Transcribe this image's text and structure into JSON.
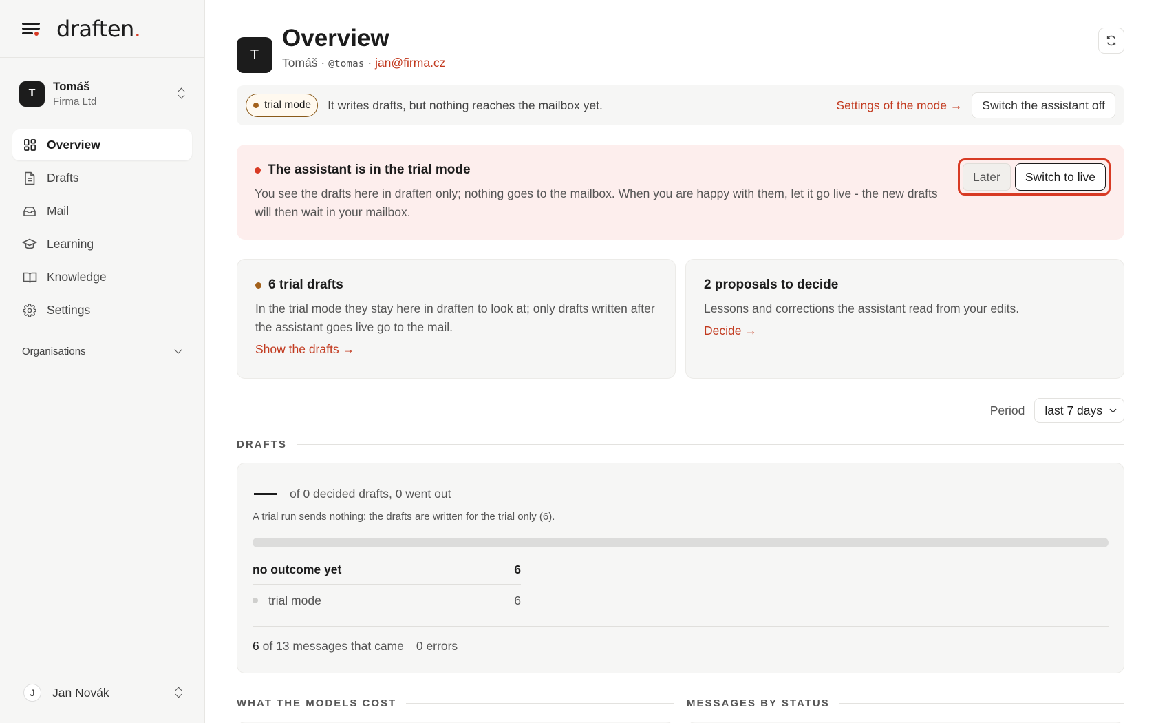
{
  "brand": {
    "name": "draften",
    "dot": ".",
    "accent": "#d83a24"
  },
  "account": {
    "initial": "T",
    "name": "Tomáš",
    "org": "Firma Ltd"
  },
  "nav": {
    "items": [
      {
        "label": "Overview",
        "icon": "grid-icon",
        "active": true
      },
      {
        "label": "Drafts",
        "icon": "document-icon",
        "active": false
      },
      {
        "label": "Mail",
        "icon": "inbox-icon",
        "active": false
      },
      {
        "label": "Learning",
        "icon": "graduation-cap-icon",
        "active": false
      },
      {
        "label": "Knowledge",
        "icon": "book-icon",
        "active": false
      },
      {
        "label": "Settings",
        "icon": "gear-icon",
        "active": false
      }
    ],
    "organisations_label": "Organisations"
  },
  "user": {
    "initial": "J",
    "name": "Jan Novák"
  },
  "header": {
    "initial": "T",
    "title": "Overview",
    "name": "Tomáš",
    "separator": " · ",
    "handle": "@tomas",
    "email": "jan@firma.cz"
  },
  "mode_bar": {
    "badge": "trial mode",
    "text": "It writes drafts, but nothing reaches the mailbox yet.",
    "settings_link": "Settings of the mode →",
    "off_button": "Switch the assistant off"
  },
  "alert": {
    "title": "The assistant is in the trial mode",
    "body": "You see the drafts here in draften only; nothing goes to the mailbox. When you are happy with them, let it go live - the new drafts will then wait in your mailbox.",
    "later_button": "Later",
    "live_button": "Switch to live"
  },
  "cards": {
    "trial": {
      "title": "6 trial drafts",
      "body": "In the trial mode they stay here in draften to look at; only drafts written after the assistant goes live go to the mail.",
      "link": "Show the drafts →"
    },
    "proposals": {
      "title": "2 proposals to decide",
      "body": "Lessons and corrections the assistant read from your edits.",
      "link": "Decide →"
    }
  },
  "period": {
    "label": "Period",
    "value": "last 7 days"
  },
  "drafts_section": {
    "label": "DRAFTS",
    "headline": "of 0 decided drafts, 0 went out",
    "note": "A trial run sends nothing: the drafts are written for the trial only (6).",
    "progress_fraction": 0,
    "no_outcome_label": "no outcome yet",
    "no_outcome_value": "6",
    "trial_label": "trial mode",
    "trial_value": "6",
    "messages_count": "6",
    "messages_text": "of 13 messages that came",
    "errors_text": "0 errors"
  },
  "bottom_sections": {
    "costs_label": "WHAT THE MODELS COST",
    "status_label": "MESSAGES BY STATUS"
  }
}
